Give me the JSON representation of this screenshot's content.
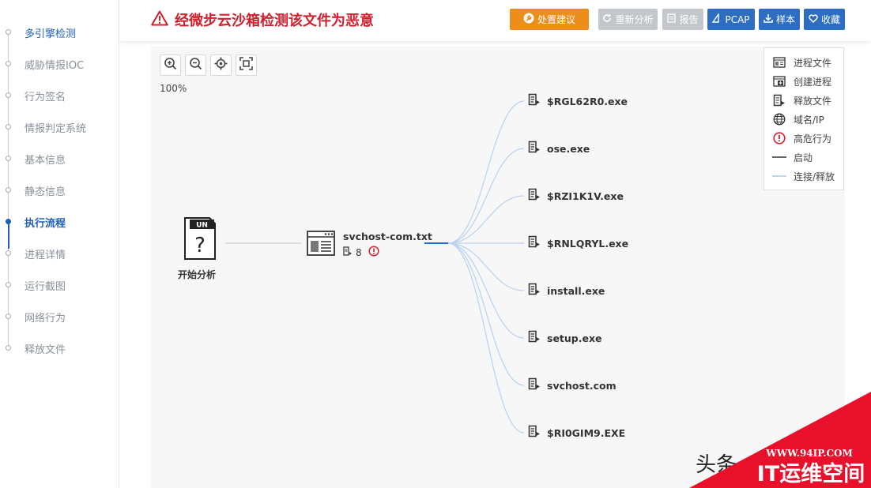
{
  "sidebar": {
    "items": [
      {
        "label": "多引擎检测"
      },
      {
        "label": "威胁情报IOC"
      },
      {
        "label": "行为签名"
      },
      {
        "label": "情报判定系统"
      },
      {
        "label": "基本信息"
      },
      {
        "label": "静态信息"
      },
      {
        "label": "执行流程"
      },
      {
        "label": "进程详情"
      },
      {
        "label": "运行截图"
      },
      {
        "label": "网络行为"
      },
      {
        "label": "释放文件"
      }
    ],
    "active": "执行流程"
  },
  "header": {
    "verdict": "经微步云沙箱检测该文件为恶意",
    "buttons": {
      "advice": "处置建议",
      "reanalyze": "重新分析",
      "report": "报告",
      "pcap": "PCAP",
      "sample": "样本",
      "favorite": "收藏"
    }
  },
  "graph": {
    "zoom_level": "100%",
    "start_node": {
      "badge": "UN",
      "label": "开始分析"
    },
    "process": {
      "name": "svchost-com.txt",
      "dropped_count": "8"
    },
    "children": [
      {
        "name": "$RGL62R0.exe"
      },
      {
        "name": "ose.exe"
      },
      {
        "name": "$RZI1K1V.exe"
      },
      {
        "name": "$RNLQRYL.exe"
      },
      {
        "name": "install.exe"
      },
      {
        "name": "setup.exe"
      },
      {
        "name": "svchost.com"
      },
      {
        "name": "$RI0GIM9.EXE"
      }
    ]
  },
  "legend": {
    "process_file": "进程文件",
    "create_process": "创建进程",
    "dropped_file": "释放文件",
    "domain_ip": "域名/IP",
    "high_risk": "高危行为",
    "launch": "启动",
    "connect_release": "连接/释放"
  },
  "watermark": {
    "site": "WWW.94IP.COM",
    "brand": "IT运维空间",
    "source": "头条"
  },
  "colors": {
    "primary_blue": "#2d6ec4",
    "danger_red": "#d0202d",
    "warning_orange": "#ed8e1a",
    "disabled_gray": "#c3c6cb",
    "watermark_red": "#e8102a"
  }
}
